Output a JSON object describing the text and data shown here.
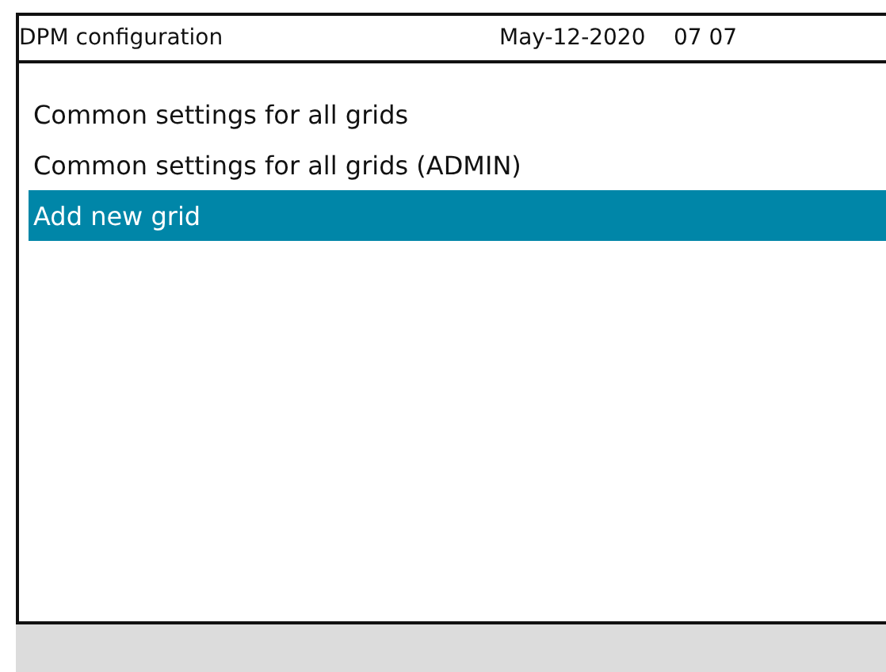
{
  "header": {
    "title": "DPM configuration",
    "date": "May-12-2020",
    "time": "07 07"
  },
  "menu": [
    {
      "label": "Common settings for all grids",
      "selected": false
    },
    {
      "label": "Common settings for all grids (ADMIN)",
      "selected": false
    },
    {
      "label": "Add new grid",
      "selected": true
    }
  ]
}
